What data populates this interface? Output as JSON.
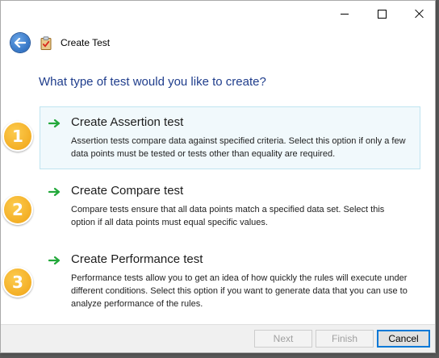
{
  "window": {
    "header_title": "Create Test"
  },
  "question": "What type of test would you like to create?",
  "options": [
    {
      "number": "1",
      "title": "Create Assertion test",
      "description": "Assertion tests compare data against specified criteria. Select this option if only a few data points must be tested or tests other than equality are required.",
      "selected": true
    },
    {
      "number": "2",
      "title": "Create Compare test",
      "description": "Compare tests ensure that all data points match a specified data set. Select this option if all data points must equal specific values.",
      "selected": false
    },
    {
      "number": "3",
      "title": "Create Performance test",
      "description": "Performance tests allow you to get an idea of how quickly the rules will execute under different conditions. Select this option if you want to generate data that you can use to analyze performance of the rules.",
      "selected": false
    }
  ],
  "footer": {
    "next_label": "Next",
    "finish_label": "Finish",
    "cancel_label": "Cancel"
  },
  "colors": {
    "question_text": "#1f3d8c",
    "badge": "#f5b21f",
    "arrow": "#22a83a",
    "selected_bg": "#f1f9fc",
    "accent_focus": "#0078d7"
  },
  "icons": {
    "back": "back-arrow-icon",
    "header": "clipboard-check-icon",
    "option_arrow": "green-arrow-icon"
  }
}
